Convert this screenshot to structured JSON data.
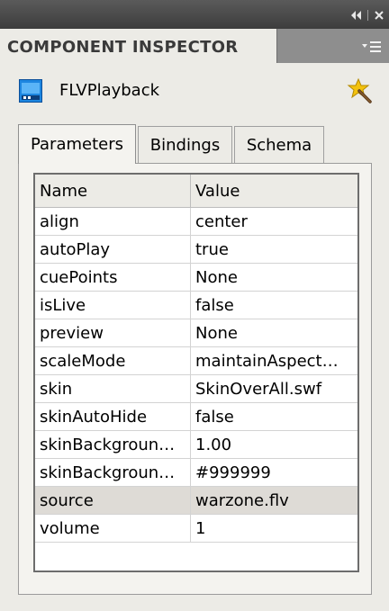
{
  "panel": {
    "title": "COMPONENT INSPECTOR",
    "component_name": "FLVPlayback"
  },
  "tabs": [
    {
      "label": "Parameters"
    },
    {
      "label": "Bindings"
    },
    {
      "label": "Schema"
    }
  ],
  "grid": {
    "headers": {
      "name": "Name",
      "value": "Value"
    },
    "rows": [
      {
        "name": "align",
        "value": "center"
      },
      {
        "name": "autoPlay",
        "value": "true"
      },
      {
        "name": "cuePoints",
        "value": "None"
      },
      {
        "name": "isLive",
        "value": "false"
      },
      {
        "name": "preview",
        "value": "None"
      },
      {
        "name": "scaleMode",
        "value": "maintainAspect…"
      },
      {
        "name": "skin",
        "value": "SkinOverAll.swf"
      },
      {
        "name": "skinAutoHide",
        "value": "false"
      },
      {
        "name": "skinBackgroun…",
        "value": "1.00"
      },
      {
        "name": "skinBackgroun…",
        "value": "#999999"
      },
      {
        "name": "source",
        "value": "warzone.flv"
      },
      {
        "name": "volume",
        "value": "1"
      }
    ],
    "selected_row_index": 10
  },
  "icons": {
    "collapse": "double-left-arrow-icon",
    "close": "close-icon",
    "panel_menu": "panel-menu-icon",
    "component": "flv-component-icon",
    "action": "wand-star-icon"
  },
  "colors": {
    "titlebar": "#4a4a4a",
    "panel_bg": "#ecebe6",
    "selected_row": "#dedbd6",
    "grid_border": "#6d6d6d"
  }
}
